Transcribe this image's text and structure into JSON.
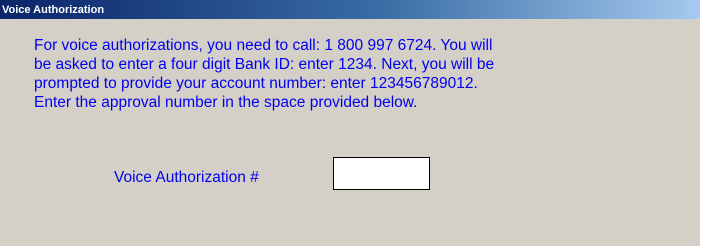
{
  "window": {
    "title": "Voice Authorization"
  },
  "instructions": {
    "lines": [
      "For voice authorizations, you need to call:  1 800 997 6724.  You will",
      "be asked to enter a four digit Bank ID:  enter 1234.  Next, you will be",
      "prompted to provide your account number:  enter 123456789012.",
      "Enter the approval number in the space provided below."
    ]
  },
  "form": {
    "voice_auth_label": "Voice Authorization #",
    "voice_auth_value": ""
  },
  "colors": {
    "text_accent": "#0000ee",
    "window_background": "#d4d0c8",
    "titlebar_start": "#0a246a",
    "titlebar_end": "#a6caf0"
  }
}
